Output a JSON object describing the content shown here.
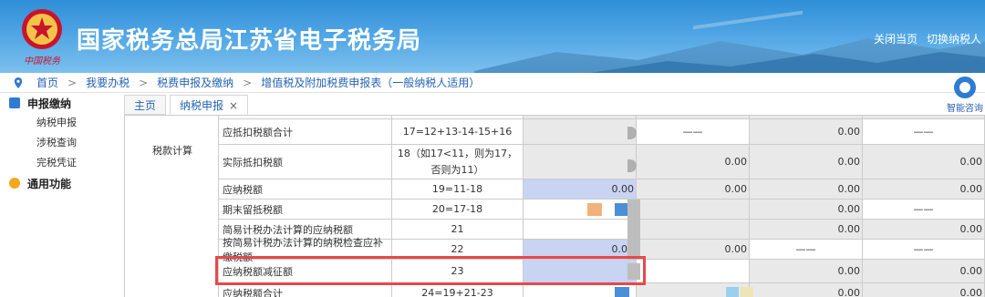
{
  "header": {
    "title": "国家税务总局江苏省电子税务局",
    "brand_small": "中国税务",
    "links": [
      "关闭当页",
      "切换纳税人"
    ]
  },
  "breadcrumb": [
    "首页",
    "我要办税",
    "税费申报及缴纳",
    "增值税及附加税费申报表（一般纳税人适用）"
  ],
  "sidebar": {
    "groups": [
      {
        "label": "申报缴纳",
        "items": [
          "纳税申报",
          "涉税查询",
          "完税凭证"
        ]
      },
      {
        "label": "通用功能",
        "items": []
      }
    ]
  },
  "tabs": [
    {
      "label": "主页"
    },
    {
      "label": "纳税申报",
      "close": "×"
    }
  ],
  "help": {
    "label": "智能咨询"
  },
  "table": {
    "category": "税款计算",
    "rows": [
      {
        "name": "应抵扣税额合计",
        "formula": "17=12+13-14-15+16",
        "v1": "",
        "v2": "——",
        "v3": "0.00",
        "v4": "——"
      },
      {
        "name": "实际抵扣税额",
        "formula": "18（如17<11，则为17，否则为11）",
        "v1": "",
        "v2": "0.00",
        "v3": "0.00",
        "v4": "0.00"
      },
      {
        "name": "应纳税额",
        "formula": "19=11-18",
        "v1": "0.00",
        "v2": "0.00",
        "v3": "0.00",
        "v4": "0.00"
      },
      {
        "name": "期末留抵税额",
        "formula": "20=17-18",
        "v1": "",
        "v2": "",
        "v3": "0.00",
        "v4": "——"
      },
      {
        "name": "简易计税办法计算的应纳税额",
        "formula": "21",
        "v1": "",
        "v2": "",
        "v3": "0.00",
        "v4": "0.00"
      },
      {
        "name": "按简易计税办法计算的纳税检查应补缴税额",
        "formula": "22",
        "v1": "0.00",
        "v2": "0.00",
        "v3": "——",
        "v4": "——"
      },
      {
        "name": "应纳税额减征额",
        "formula": "23",
        "v1": "",
        "v2": "",
        "v3": "0.00",
        "v4": "0.00"
      },
      {
        "name": "应纳税额合计",
        "formula": "24=19+21-23",
        "v1": "",
        "v2": "",
        "v3": "0.00",
        "v4": "0.00"
      }
    ]
  },
  "colors": {
    "accent": "#2563b6",
    "highlight": "#e8484b",
    "input_blue": "#c9d3f2",
    "readonly_gray": "#e9e9e9"
  }
}
